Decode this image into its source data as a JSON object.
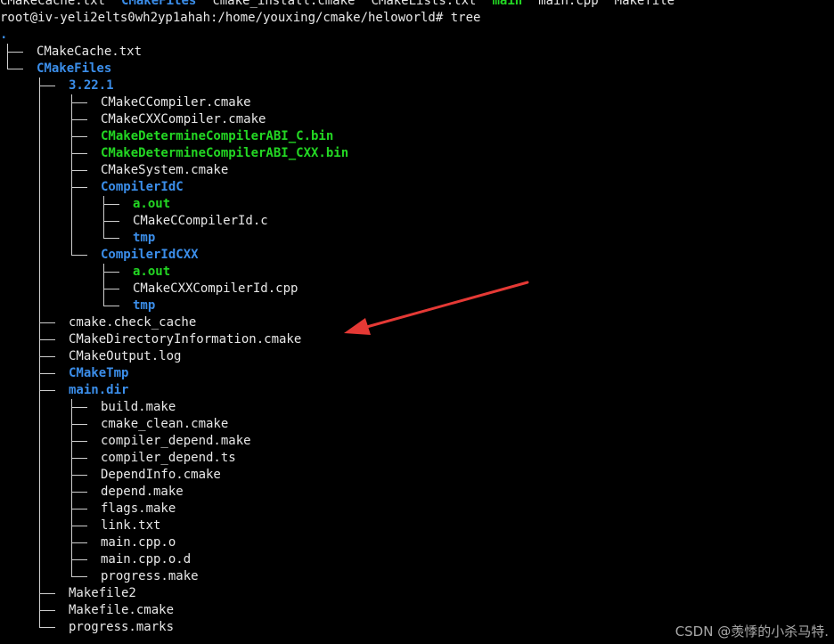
{
  "ls_line": [
    {
      "text": "CMakeCache.txt",
      "kind": "file"
    },
    {
      "text": "CMakeFiles",
      "kind": "dir"
    },
    {
      "text": "cmake_install.cmake",
      "kind": "file"
    },
    {
      "text": "CMakeLists.txt",
      "kind": "file"
    },
    {
      "text": "main",
      "kind": "exe"
    },
    {
      "text": "main.cpp",
      "kind": "file"
    },
    {
      "text": "Makefile",
      "kind": "file"
    }
  ],
  "prompt": "root@iv-yeli2elts0wh2yp1ahah:/home/youxing/cmake/heloworld# tree",
  "tree_root": ".",
  "tree": [
    {
      "depth": 0,
      "text": "CMakeCache.txt",
      "kind": "file"
    },
    {
      "depth": 0,
      "text": "CMakeFiles",
      "kind": "dir"
    },
    {
      "depth": 1,
      "text": "3.22.1",
      "kind": "dir"
    },
    {
      "depth": 2,
      "text": "CMakeCCompiler.cmake",
      "kind": "file"
    },
    {
      "depth": 2,
      "text": "CMakeCXXCompiler.cmake",
      "kind": "file"
    },
    {
      "depth": 2,
      "text": "CMakeDetermineCompilerABI_C.bin",
      "kind": "exe"
    },
    {
      "depth": 2,
      "text": "CMakeDetermineCompilerABI_CXX.bin",
      "kind": "exe"
    },
    {
      "depth": 2,
      "text": "CMakeSystem.cmake",
      "kind": "file"
    },
    {
      "depth": 2,
      "text": "CompilerIdC",
      "kind": "dir"
    },
    {
      "depth": 3,
      "text": "a.out",
      "kind": "exe"
    },
    {
      "depth": 3,
      "text": "CMakeCCompilerId.c",
      "kind": "file"
    },
    {
      "depth": 3,
      "text": "tmp",
      "kind": "dir"
    },
    {
      "depth": 2,
      "text": "CompilerIdCXX",
      "kind": "dir"
    },
    {
      "depth": 3,
      "text": "a.out",
      "kind": "exe"
    },
    {
      "depth": 3,
      "text": "CMakeCXXCompilerId.cpp",
      "kind": "file"
    },
    {
      "depth": 3,
      "text": "tmp",
      "kind": "dir"
    },
    {
      "depth": 1,
      "text": "cmake.check_cache",
      "kind": "file"
    },
    {
      "depth": 1,
      "text": "CMakeDirectoryInformation.cmake",
      "kind": "file"
    },
    {
      "depth": 1,
      "text": "CMakeOutput.log",
      "kind": "file"
    },
    {
      "depth": 1,
      "text": "CMakeTmp",
      "kind": "dir"
    },
    {
      "depth": 1,
      "text": "main.dir",
      "kind": "dir"
    },
    {
      "depth": 2,
      "text": "build.make",
      "kind": "file"
    },
    {
      "depth": 2,
      "text": "cmake_clean.cmake",
      "kind": "file"
    },
    {
      "depth": 2,
      "text": "compiler_depend.make",
      "kind": "file"
    },
    {
      "depth": 2,
      "text": "compiler_depend.ts",
      "kind": "file"
    },
    {
      "depth": 2,
      "text": "DependInfo.cmake",
      "kind": "file"
    },
    {
      "depth": 2,
      "text": "depend.make",
      "kind": "file"
    },
    {
      "depth": 2,
      "text": "flags.make",
      "kind": "file"
    },
    {
      "depth": 2,
      "text": "link.txt",
      "kind": "file"
    },
    {
      "depth": 2,
      "text": "main.cpp.o",
      "kind": "file"
    },
    {
      "depth": 2,
      "text": "main.cpp.o.d",
      "kind": "file"
    },
    {
      "depth": 2,
      "text": "progress.make",
      "kind": "file"
    },
    {
      "depth": 1,
      "text": "Makefile2",
      "kind": "file"
    },
    {
      "depth": 1,
      "text": "Makefile.cmake",
      "kind": "file"
    },
    {
      "depth": 1,
      "text": "progress.marks",
      "kind": "file"
    }
  ],
  "watermark": "CSDN @羡悸的小杀马特.",
  "annotation": {
    "icon": "red-arrow-icon",
    "color": "#e53935"
  },
  "colors": {
    "background": "#000000",
    "file": "#e8e8e8",
    "dir": "#3b8eea",
    "exe": "#23d723"
  }
}
